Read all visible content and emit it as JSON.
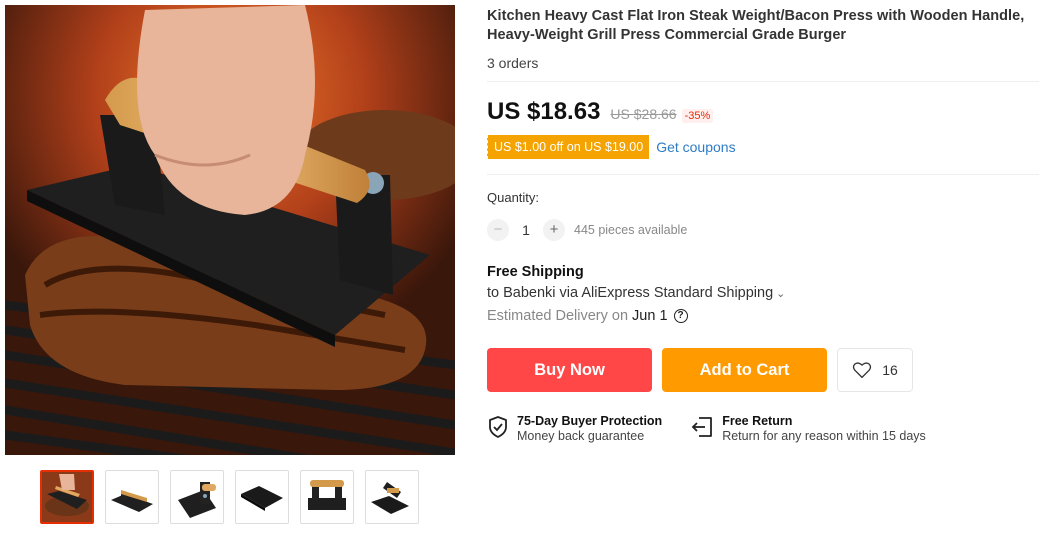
{
  "product": {
    "title": "Kitchen Heavy Cast Flat Iron Steak Weight/Bacon Press with Wooden Handle, Heavy-Weight Grill Press Commercial Grade Burger",
    "orders": "3 orders"
  },
  "price": {
    "current": "US $18.63",
    "original": "US $28.66",
    "discount": "-35%"
  },
  "coupon": {
    "badge": "US $1.00 off on US $19.00",
    "link": "Get coupons"
  },
  "quantity": {
    "label": "Quantity:",
    "minus": "−",
    "value": "1",
    "plus": "+",
    "available": "445 pieces available"
  },
  "shipping": {
    "title": "Free Shipping",
    "line": "to Babenki via AliExpress Standard Shipping",
    "chevron": "⌄",
    "delivery_label": "Estimated Delivery on",
    "delivery_date": "Jun 1",
    "help": "?"
  },
  "actions": {
    "buy_now": "Buy Now",
    "add_to_cart": "Add to Cart",
    "wishlist_count": "16"
  },
  "guarantees": {
    "protection_title": "75-Day Buyer Protection",
    "protection_desc": "Money back guarantee",
    "return_title": "Free Return",
    "return_desc": "Return for any reason within 15 days"
  },
  "gallery": {
    "active_index": 0,
    "thumbnail_count": 6
  },
  "colors": {
    "buy_now": "#ff4747",
    "add_to_cart": "#ff9a00",
    "coupon_badge": "#f5a300",
    "link": "#2e7cc4",
    "discount": "#e62e04"
  }
}
